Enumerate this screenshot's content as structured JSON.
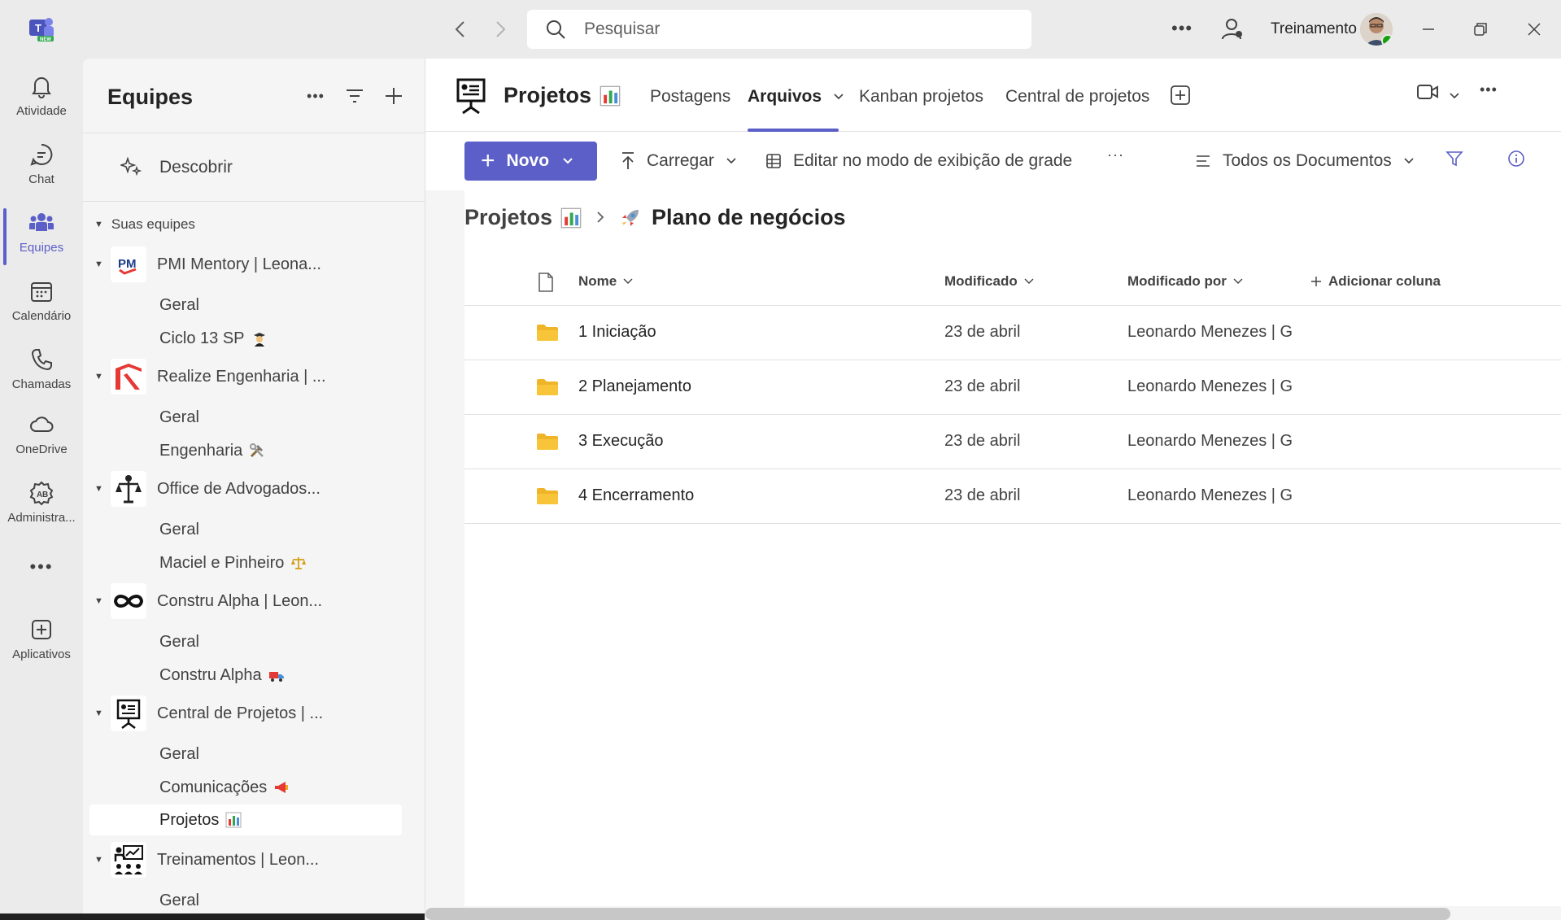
{
  "titlebar": {
    "search_placeholder": "Pesquisar",
    "user_name": "Treinamento",
    "badge": "NEW"
  },
  "rail": {
    "items": [
      {
        "label": "Atividade",
        "icon": "bell-icon"
      },
      {
        "label": "Chat",
        "icon": "chat-icon"
      },
      {
        "label": "Equipes",
        "icon": "teams-icon"
      },
      {
        "label": "Calendário",
        "icon": "calendar-icon"
      },
      {
        "label": "Chamadas",
        "icon": "phone-icon"
      },
      {
        "label": "OneDrive",
        "icon": "cloud-icon"
      },
      {
        "label": "Administra...",
        "icon": "admin-icon"
      },
      {
        "label": "Aplicativos",
        "icon": "apps-icon"
      }
    ],
    "more": "···"
  },
  "teams_pane": {
    "title": "Equipes",
    "discover": "Descobrir",
    "section": "Suas equipes",
    "teams": [
      {
        "name": "PMI Mentory | Leona...",
        "channels": [
          "Geral",
          "Ciclo 13 SP"
        ]
      },
      {
        "name": "Realize Engenharia | ...",
        "channels": [
          "Geral",
          "Engenharia"
        ]
      },
      {
        "name": "Office de Advogados...",
        "channels": [
          "Geral",
          "Maciel e Pinheiro"
        ]
      },
      {
        "name": "Constru Alpha | Leon...",
        "channels": [
          "Geral",
          "Constru Alpha"
        ]
      },
      {
        "name": "Central de Projetos | ...",
        "channels": [
          "Geral",
          "Comunicações",
          "Projetos"
        ]
      },
      {
        "name": "Treinamentos | Leon...",
        "channels": [
          "Geral"
        ]
      }
    ],
    "pmi_logo_text": "PM"
  },
  "channel_header": {
    "title": "Projetos",
    "tabs": [
      "Postagens",
      "Arquivos",
      "Kanban projetos",
      "Central de projetos"
    ],
    "active_tab": "Arquivos"
  },
  "toolbar": {
    "new_label": "Novo",
    "upload_label": "Carregar",
    "grid_edit_label": "Editar no modo de exibição de grade",
    "more": "···",
    "view_label": "Todos os Documentos"
  },
  "breadcrumb": {
    "root": "Projetos",
    "current": "Plano de negócios"
  },
  "file_list": {
    "columns": {
      "name": "Nome",
      "modified": "Modificado",
      "modified_by": "Modificado por",
      "add_column": "Adicionar coluna"
    },
    "rows": [
      {
        "name": "1 Iniciação",
        "modified": "23 de abril",
        "modified_by": "Leonardo Menezes | G"
      },
      {
        "name": "2 Planejamento",
        "modified": "23 de abril",
        "modified_by": "Leonardo Menezes | G"
      },
      {
        "name": "3 Execução",
        "modified": "23 de abril",
        "modified_by": "Leonardo Menezes | G"
      },
      {
        "name": "4 Encerramento",
        "modified": "23 de abril",
        "modified_by": "Leonardo Menezes | G"
      }
    ]
  },
  "colors": {
    "accent": "#5b5fc7",
    "folder": "#f8c53a",
    "presence": "#13a10e"
  }
}
